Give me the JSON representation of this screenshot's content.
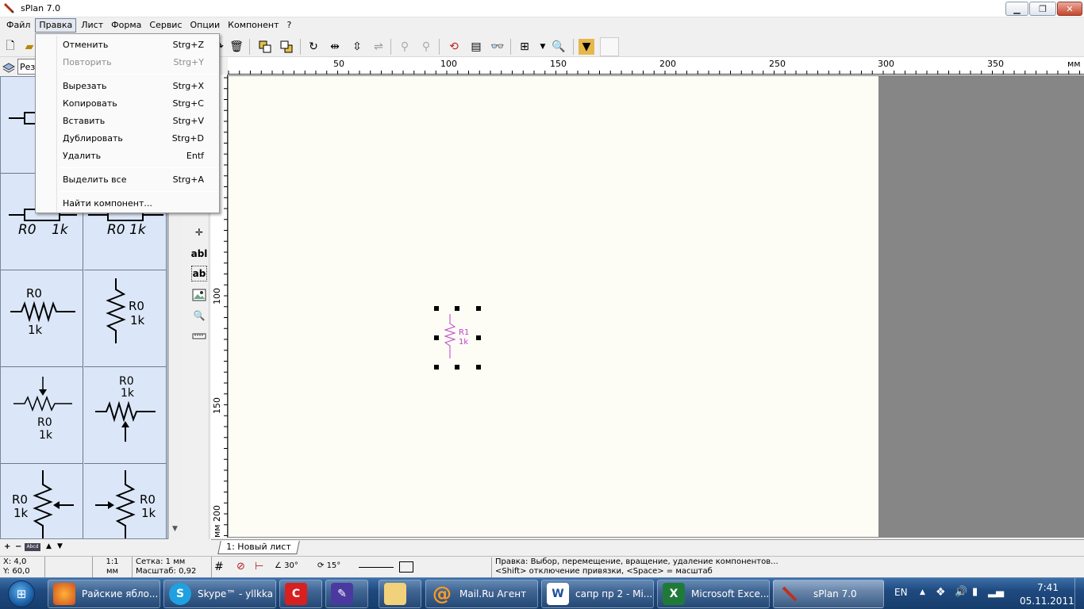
{
  "window": {
    "title": "sPlan 7.0",
    "minimize": "▁",
    "maximize": "❐",
    "close": "✕"
  },
  "menubar": [
    "Файл",
    "Правка",
    "Лист",
    "Форма",
    "Сервис",
    "Опции",
    "Компонент",
    "?"
  ],
  "edit_menu": {
    "items": [
      {
        "label": "Отменить",
        "shortcut": "Strg+Z"
      },
      {
        "label": "Повторить",
        "shortcut": "Strg+Y"
      },
      {
        "label": "Вырезать",
        "shortcut": "Strg+X"
      },
      {
        "label": "Копировать",
        "shortcut": "Strg+C"
      },
      {
        "label": "Вставить",
        "shortcut": "Strg+V"
      },
      {
        "label": "Дублировать",
        "shortcut": "Strg+D"
      },
      {
        "label": "Удалить",
        "shortcut": "Entf"
      },
      {
        "label": "Выделить все",
        "shortcut": "Strg+A"
      },
      {
        "label": "Найти компонент...",
        "shortcut": ""
      }
    ]
  },
  "library": {
    "combo_value": "Рез"
  },
  "library_cells": {
    "c1": {
      "a": "R0",
      "b": "1k"
    },
    "c2": {
      "a": "R0 1k"
    },
    "c3": {
      "a": "R0",
      "b": "1k"
    },
    "c4": {
      "a": "R0",
      "b": "1k"
    },
    "c5": {
      "a": "R0",
      "b": "1k"
    },
    "c6": {
      "a": "R0",
      "b": "1k"
    },
    "c7": {
      "a": "R0",
      "b": "1k"
    },
    "c8": {
      "a": "R0",
      "b": "1k"
    }
  },
  "vtools": {
    "text1": "abl",
    "text2": "ab"
  },
  "ruler": {
    "h": [
      "50",
      "100",
      "150",
      "200",
      "250",
      "300",
      "350"
    ],
    "h_unit": "мм",
    "v": [
      "100",
      "150",
      "200"
    ],
    "v_unit": "мм"
  },
  "component": {
    "ref": "R1",
    "value": "1k",
    "color": "#c040c8"
  },
  "sheet_tab": "1: Новый лист",
  "statusbar": {
    "x": "X: 4,0",
    "y": "Y: 60,0",
    "scale_a": "1:1",
    "scale_b": "мм",
    "grid": "Сетка: 1 мм",
    "zoom": "Масштаб:  0,92",
    "angle1": "30°",
    "angle2": "15°",
    "hint1": "Правка: Выбор, перемещение, вращение, удаление компонентов...",
    "hint2": "<Shift> отключение привязки, <Space> = масштаб"
  },
  "taskbar": {
    "items": [
      {
        "label": "Райские ябло...",
        "icon": "firefox-icon"
      },
      {
        "label": "Skype™ - yllkka",
        "icon": "skype-icon"
      },
      {
        "label": "",
        "icon": "app-red-icon"
      },
      {
        "label": "",
        "icon": "pen-app-icon"
      },
      {
        "label": "",
        "icon": "folder-icon"
      },
      {
        "label": "Mail.Ru Агент",
        "icon": "mailru-icon"
      },
      {
        "label": "сапр пр 2 - Mi...",
        "icon": "word-icon"
      },
      {
        "label": "Microsoft Exce...",
        "icon": "excel-icon"
      },
      {
        "label": "sPlan 7.0",
        "icon": "splan-icon"
      }
    ],
    "lang": "EN",
    "time": "7:41",
    "date": "05.11.2011"
  }
}
